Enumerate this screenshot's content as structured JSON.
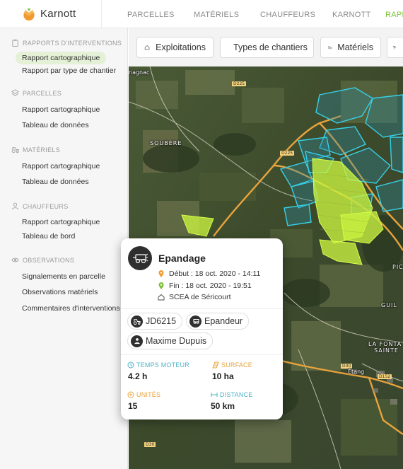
{
  "brand": {
    "name": "Karnott",
    "color": "#7cc03a",
    "logo_color": "#f29a2e"
  },
  "nav": {
    "items": [
      "PARCELLES",
      "MATÉRIELS",
      "CHAUFFEURS",
      "KARNOTT",
      "RAPP"
    ],
    "active_index": 4
  },
  "sidebar": {
    "sections": [
      {
        "title": "RAPPORTS D'INTERVENTIONS",
        "icon": "clipboard-icon",
        "items": [
          "Rapport cartographique",
          "Rapport par type de chantier"
        ]
      },
      {
        "title": "PARCELLES",
        "icon": "layers-icon",
        "items": [
          "Rapport cartographique",
          "Tableau de données"
        ]
      },
      {
        "title": "MATÉRIELS",
        "icon": "tractor-icon",
        "items": [
          "Rapport cartographique",
          "Tableau de données"
        ]
      },
      {
        "title": "CHAUFFEURS",
        "icon": "driver-icon",
        "items": [
          "Rapport cartographique",
          "Tableau de bord"
        ]
      },
      {
        "title": "OBSERVATIONS",
        "icon": "eye-icon",
        "items": [
          "Signalements en parcelle",
          "Observations matériels",
          "Commentaires d'interventions"
        ]
      }
    ],
    "active_item": "Rapport cartographique"
  },
  "filters": {
    "buttons": [
      {
        "label": "Exploitations",
        "icon": "home-icon"
      },
      {
        "label": "Types de chantiers",
        "icon": "tractor-icon"
      },
      {
        "label": "Matériels",
        "icon": "tractor-icon"
      }
    ]
  },
  "map": {
    "roads": [
      "D225",
      "D225",
      "D30",
      "D30",
      "D152"
    ],
    "places": [
      "nagnac",
      "SOUBÈRE",
      "PIC",
      "GUIL",
      "LA FONTA",
      "SAINTE",
      "Étang"
    ]
  },
  "popup": {
    "title": "Epandage",
    "start": "Début : 18 oct. 2020 - 14:11",
    "end": "Fin : 18 oct. 2020 - 19:51",
    "farm": "SCEA de Séricourt",
    "chips": [
      {
        "label": "JD6215",
        "icon": "tractor-icon"
      },
      {
        "label": "Epandeur",
        "icon": "spreader-icon"
      },
      {
        "label": "Maxime Dupuis",
        "icon": "driver-icon"
      }
    ],
    "stats": [
      {
        "label": "TEMPS MOTEUR",
        "value": "4.2 h",
        "color": "#4fb3c6",
        "icon": "clock-icon"
      },
      {
        "label": "SURFACE",
        "value": "10 ha",
        "color": "#e8a33c",
        "icon": "area-icon"
      },
      {
        "label": "UNITÉS",
        "value": "15",
        "color": "#e8a33c",
        "icon": "plus-circle-icon"
      },
      {
        "label": "DISTANCE",
        "value": "50 km",
        "color": "#4fb3c6",
        "icon": "distance-icon"
      }
    ]
  }
}
